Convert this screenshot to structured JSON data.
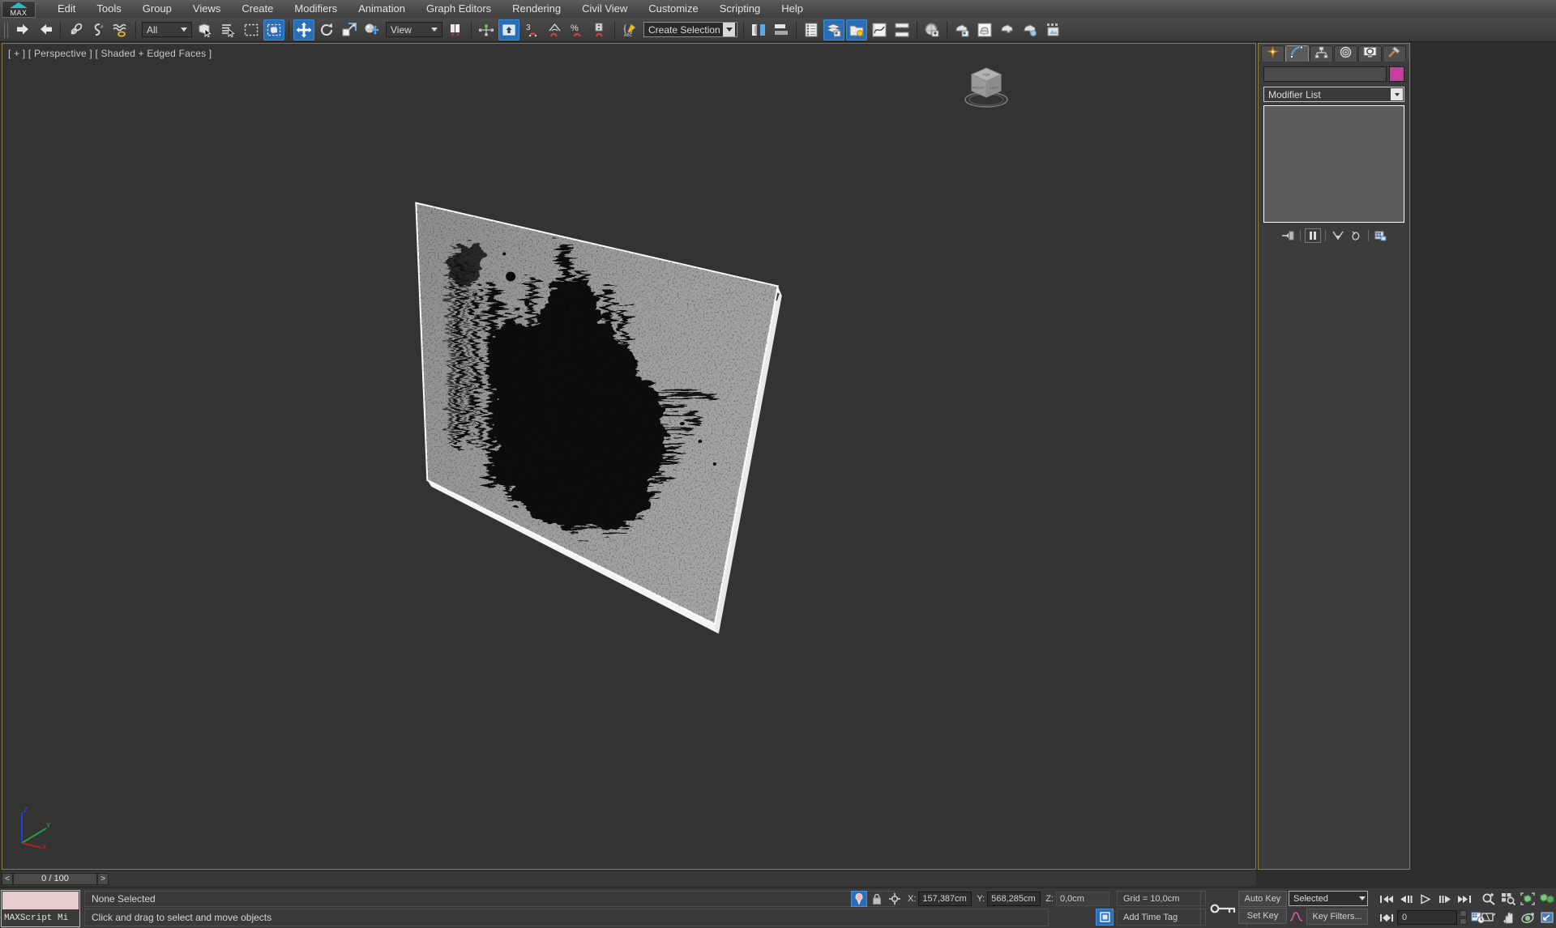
{
  "app": {
    "logo_label": "MAX",
    "menus": [
      "Edit",
      "Tools",
      "Group",
      "Views",
      "Create",
      "Modifiers",
      "Animation",
      "Graph Editors",
      "Rendering",
      "Civil View",
      "Customize",
      "Scripting",
      "Help"
    ]
  },
  "toolbar": {
    "undo": "Undo",
    "redo": "Redo",
    "select_link": "Select and Link",
    "unlink": "Unlink Selection",
    "bind_space_warp": "Bind to Space Warp",
    "selection_filter_value": "All",
    "select_object": "Select Object",
    "select_by_name": "Select by Name",
    "rect_selection_region": "Rectangular Selection Region",
    "window_crossing": "Window/Crossing",
    "select_and_move": "Select and Move",
    "select_and_rotate": "Select and Rotate",
    "select_and_scale": "Select and Uniform Scale",
    "select_and_place": "Select and Place",
    "reference_coord_value": "View",
    "use_pivot_center": "Use Pivot Point Center",
    "snap_toggle": "Snaps Toggle",
    "snap_3d": "3",
    "angle_snap": "Angle Snap Toggle",
    "percent_snap": "Percent Snap Toggle",
    "spinner_snap": "Spinner Snap Toggle",
    "edit_named_sets": "Edit Named Selection Sets",
    "selection_set_placeholder": "Create Selection Se",
    "mirror": "Mirror",
    "align": "Align",
    "layer_explorer": "Layer Explorer",
    "toggle_scene_explorer": "Toggle Scene Explorer",
    "layer_manager": "Manage Layers",
    "curve_editor": "Curve Editor",
    "schematic_view": "Schematic View",
    "material_editor": "Material Editor",
    "render_setup": "Render Setup",
    "rendered_frame_window": "Rendered Frame Window",
    "render_production": "Render Production",
    "render_iterative": "Render Iterative",
    "active_shade": "ActiveShade"
  },
  "viewport": {
    "label": "[ + ] [ Perspective ] [ Shaded + Edged Faces ]",
    "background_color": "#333333",
    "plane_color": "#9a9a9a",
    "edge_color": "#ffffff",
    "object": "textured plane with black grunge splatter"
  },
  "viewcube": {
    "faces": [
      "TOP",
      "FRONT",
      "LEFT"
    ]
  },
  "axis_tripod": {
    "z": {
      "label": "Z",
      "color": "#2040d0"
    },
    "y": {
      "label": "Y",
      "color": "#20a040"
    },
    "x": {
      "label": "X",
      "color": "#b02020"
    }
  },
  "command_panel": {
    "tabs": [
      {
        "name": "create",
        "icon": "star-icon",
        "active": false
      },
      {
        "name": "modify",
        "icon": "arc-icon",
        "active": true
      },
      {
        "name": "hierarchy",
        "icon": "pivot-icon",
        "active": false
      },
      {
        "name": "motion",
        "icon": "orbit-icon",
        "active": false
      },
      {
        "name": "display",
        "icon": "monitor-icon",
        "active": false
      },
      {
        "name": "utilities",
        "icon": "hammer-icon",
        "active": false
      }
    ],
    "object_name": "",
    "object_color": "#c83fa0",
    "modifier_list_label": "Modifier List",
    "stack_items": [],
    "stack_tools": [
      "pin-stack",
      "show-end-result",
      "make-unique",
      "remove-modifier",
      "configure-modifier-sets"
    ]
  },
  "timeslider": {
    "prev_label": "<",
    "next_label": ">",
    "frame_label": "0 / 100"
  },
  "status": {
    "maxscript_label": "MAXScript Mi",
    "selection": "None Selected",
    "prompt": "Click and drag to select and move objects",
    "coords": {
      "x_label": "X:",
      "x_value": "157,387cm",
      "y_label": "Y:",
      "y_value": "568,285cm",
      "z_label": "Z:",
      "z_value": "0,0cm"
    },
    "grid": "Grid = 10,0cm",
    "add_time_tag": "Add Time Tag",
    "isolate_icon": "isolate-selection-icon",
    "lock_icon": "selection-lock-icon",
    "absolute_mode_icon": "absolute-relative-transform-icon"
  },
  "animation": {
    "auto_key": "Auto Key",
    "set_key": "Set Key",
    "key_mode_value": "Selected",
    "key_filters": "Key Filters...",
    "current_frame": "0",
    "buttons": [
      "go-to-start",
      "previous-frame",
      "play-animation",
      "next-frame",
      "go-to-end",
      "key-mode-toggle"
    ]
  },
  "nav": {
    "buttons": [
      "zoom",
      "zoom-all",
      "zoom-extents",
      "zoom-extents-all",
      "field-of-view",
      "pan",
      "orbit",
      "maximize-viewport-toggle"
    ]
  },
  "colors": {
    "accent_blue": "#2a6fb5",
    "frame_olive": "#8a8038",
    "panel_bg": "#3c3c3c",
    "viewport_bg": "#333333",
    "object_color": "#c83fa0"
  }
}
